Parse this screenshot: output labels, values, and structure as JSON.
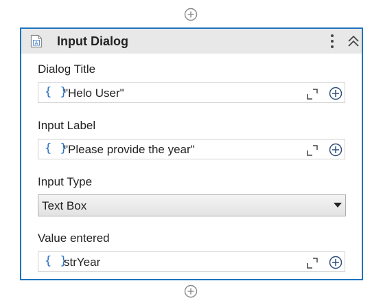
{
  "activity": {
    "title": "Input Dialog",
    "icon": "input-dialog-icon"
  },
  "fields": {
    "dialog_title": {
      "label": "Dialog Title",
      "value": "\"Helo User\""
    },
    "input_label": {
      "label": "Input Label",
      "value": "\"Please provide the year\""
    },
    "input_type": {
      "label": "Input Type",
      "selected": "Text Box"
    },
    "value_entered": {
      "label": "Value entered",
      "value": "strYear"
    }
  },
  "glyphs": {
    "brace": "{ }"
  },
  "colors": {
    "accent_border": "#1e73be",
    "brace_blue": "#2f72c4",
    "header_bg": "#e8e8e8"
  }
}
